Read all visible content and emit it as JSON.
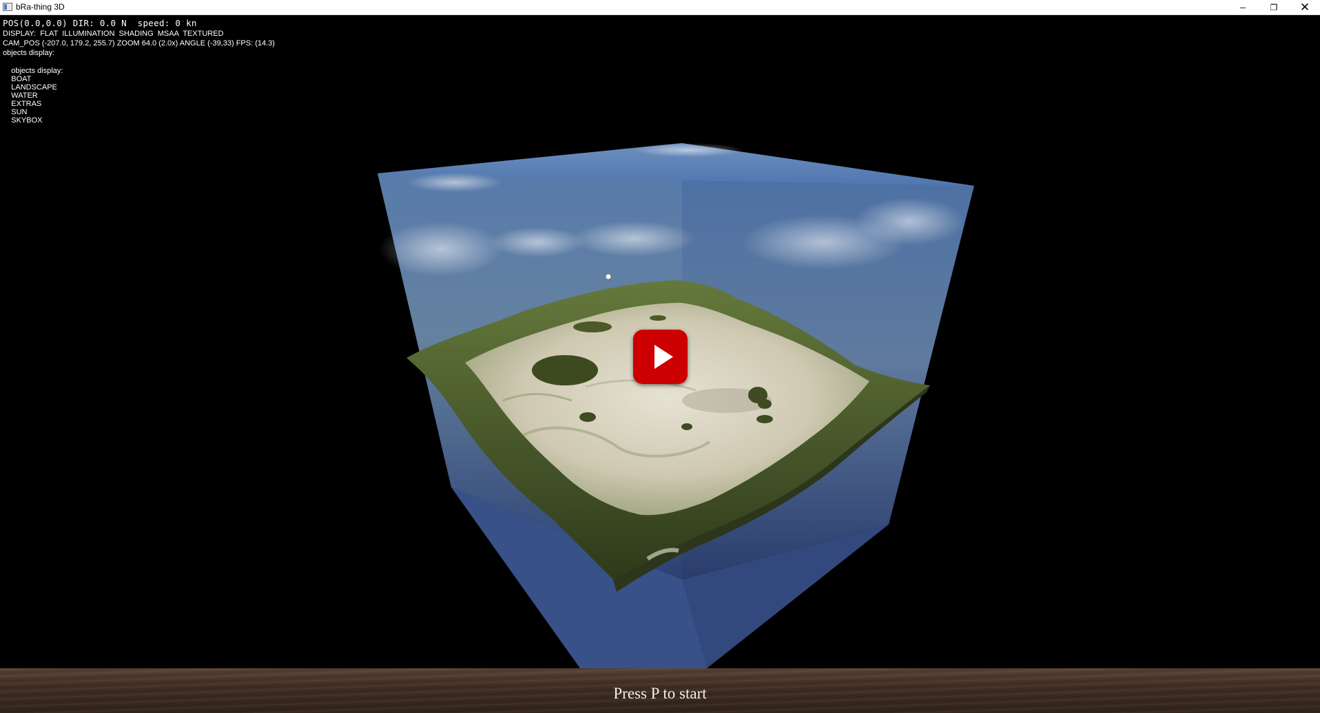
{
  "window": {
    "title": "bRa-thing 3D",
    "controls": {
      "minimize": "─",
      "restore": "❐",
      "close": "✕"
    }
  },
  "hud": {
    "line1": "POS(0.0,0.0) DIR: 0.0 N  speed: 0 kn",
    "line2": "DISPLAY:  FLAT  ILLUMINATION  SHADING  MSAA  TEXTURED",
    "line3": "CAM_POS (-207.0, 179.2, 255.7) ZOOM 64.0 (2.0x) ANGLE (-39,33) FPS: (14.3)",
    "line4": "objects display:",
    "objects_prefix": "objects display:",
    "objects": [
      "BOAT",
      "LANDSCAPE",
      "WATER",
      "EXTRAS",
      "SUN",
      "SKYBOX"
    ]
  },
  "scene": {
    "description_icons": [
      "skybox-cube",
      "terrain-island",
      "sun-dot"
    ],
    "colors": {
      "sky": "#4a6a9a",
      "terrain_edge": "#4b5f2c",
      "sand": "#d8d3c0",
      "play": "#cc0000"
    }
  },
  "overlay": {
    "play_icon": "play-icon",
    "start_prompt": "Press P to start"
  }
}
